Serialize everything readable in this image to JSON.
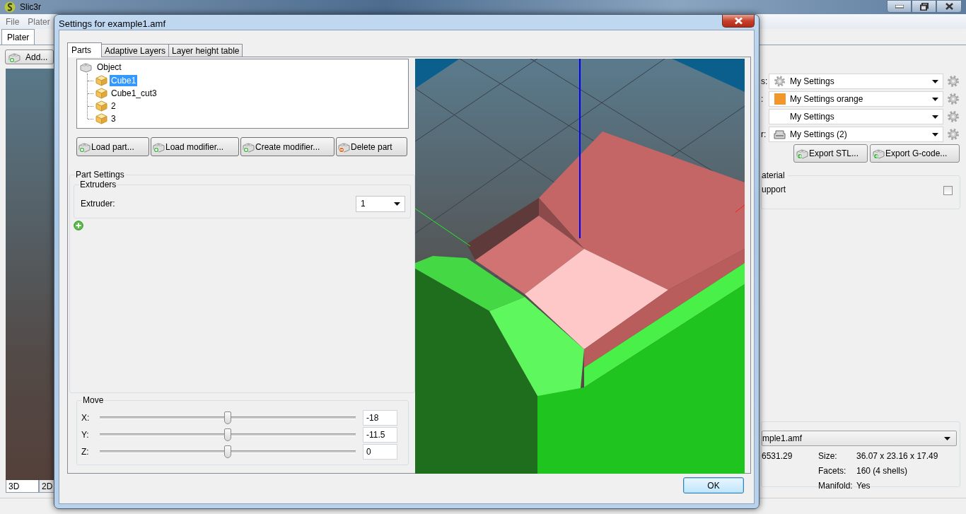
{
  "main_window": {
    "title": "Slic3r",
    "menu": [
      "File",
      "Plater"
    ],
    "tabs": [
      {
        "label": "Plater",
        "selected": true
      }
    ],
    "add_button": "Add...",
    "presets": [
      {
        "label": "s:",
        "value": "My Settings",
        "kind": "gear"
      },
      {
        "label": ":",
        "value": "My Settings orange",
        "kind": "swatch",
        "color": "#f0962a"
      },
      {
        "value": "My Settings",
        "kind": "none"
      },
      {
        "label": "r:",
        "value": "My Settings (2)",
        "kind": "printer"
      }
    ],
    "export_buttons": [
      "Export STL...",
      "Export G-code..."
    ],
    "options_group": {
      "title": "aterial",
      "support": {
        "label": "upport",
        "checked": false
      }
    },
    "object_select": "mple1.amf",
    "info": {
      "column_1_value": "6531.29",
      "rows": [
        {
          "label": "Size:",
          "value": "36.07 x 23.16 x 17.49"
        },
        {
          "label": "Facets:",
          "value": "160 (4 shells)"
        },
        {
          "label": "Manifold:",
          "value": "Yes"
        }
      ]
    },
    "view_tabs": [
      {
        "label": "3D",
        "selected": true
      },
      {
        "label": "2D",
        "selected": false
      }
    ]
  },
  "dialog": {
    "title": "Settings for example1.amf",
    "tabs": [
      {
        "label": "Parts",
        "selected": true
      },
      {
        "label": "Adaptive Layers",
        "selected": false
      },
      {
        "label": "Layer height table",
        "selected": false
      }
    ],
    "tree": {
      "label": "Object",
      "children": [
        {
          "label": "Cube1",
          "selected": true
        },
        {
          "label": "Cube1_cut3",
          "selected": false
        },
        {
          "label": "2",
          "selected": false
        },
        {
          "label": "3",
          "selected": false
        }
      ]
    },
    "part_buttons": [
      {
        "label": "Load part...",
        "kind": "add"
      },
      {
        "label": "Load modifier...",
        "kind": "add"
      },
      {
        "label": "Create modifier...",
        "kind": "add"
      },
      {
        "label": "Delete part",
        "kind": "remove"
      }
    ],
    "part_settings": {
      "title": "Part Settings",
      "group": "Extruders",
      "field": {
        "label": "Extruder:",
        "value": "1"
      }
    },
    "move": {
      "title": "Move",
      "axes": [
        {
          "label": "X:",
          "level": 0.5,
          "value": "-18"
        },
        {
          "label": "Y:",
          "level": 0.5,
          "value": "-11.5"
        },
        {
          "label": "Z:",
          "level": 0.5,
          "value": "0"
        }
      ]
    },
    "ok_button": "OK"
  }
}
